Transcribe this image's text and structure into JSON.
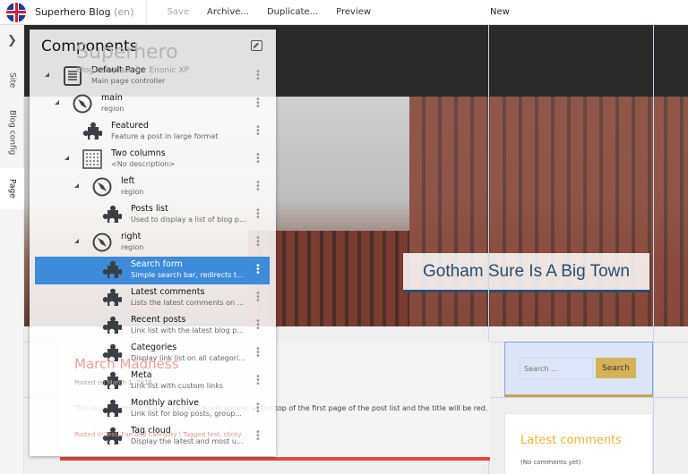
{
  "topbar": {
    "app_name": "Superhero Blog",
    "lang": "(en)",
    "save": "Save",
    "archive": "Archive...",
    "duplicate": "Duplicate...",
    "preview": "Preview",
    "status": "New"
  },
  "leftnav": {
    "tabs": [
      "Site",
      "Blog config",
      "Page"
    ],
    "active": "Page"
  },
  "site": {
    "title": "Superhero",
    "subtitle": "Blog template for Enonic XP",
    "hero_title": "Gotham Sure Is A Big Town"
  },
  "post": {
    "title": "March Madness",
    "meta": "Posted on March 1, 2016",
    "body": "This is an example of a sticky post. It will appear at the top of the first page of the post list and the title will be red.",
    "footer": "Posted in Test, Fun and Category | Tagged test, sticky"
  },
  "search_widget": {
    "placeholder": "Search ...",
    "button": "Search"
  },
  "comments_widget": {
    "title": "Latest comments",
    "empty": "(No comments yet)"
  },
  "components_panel": {
    "title": "Components",
    "items": [
      {
        "name": "Default Page",
        "desc": "Main page controller",
        "icon": "page-icon",
        "level": 0,
        "expandable": true
      },
      {
        "name": "main",
        "desc": "region",
        "icon": "region-icon",
        "level": 1,
        "expandable": true
      },
      {
        "name": "Featured",
        "desc": "Feature a post in large format",
        "icon": "puzzle-icon",
        "level": 2,
        "expandable": false
      },
      {
        "name": "Two columns",
        "desc": "<No description>",
        "icon": "layout-icon",
        "level": 2,
        "expandable": true
      },
      {
        "name": "left",
        "desc": "region",
        "icon": "region-icon",
        "level": 3,
        "expandable": true
      },
      {
        "name": "Posts list",
        "desc": "Used to display a list of blog p...",
        "icon": "puzzle-icon",
        "level": 4,
        "expandable": false
      },
      {
        "name": "right",
        "desc": "region",
        "icon": "region-icon",
        "level": 3,
        "expandable": true
      },
      {
        "name": "Search form",
        "desc": "Simple search bar, redirects t...",
        "icon": "puzzle-icon",
        "level": 4,
        "expandable": false,
        "selected": true
      },
      {
        "name": "Latest comments",
        "desc": "Lists the latest comments on ...",
        "icon": "puzzle-icon",
        "level": 4,
        "expandable": false
      },
      {
        "name": "Recent posts",
        "desc": "Link list with the latest blog p...",
        "icon": "puzzle-icon",
        "level": 4,
        "expandable": false
      },
      {
        "name": "Categories",
        "desc": "Display link list on all categori...",
        "icon": "puzzle-icon",
        "level": 4,
        "expandable": false
      },
      {
        "name": "Meta",
        "desc": "Link list with custom links",
        "icon": "puzzle-icon",
        "level": 4,
        "expandable": false
      },
      {
        "name": "Monthly archive",
        "desc": "Link list for blog posts, group...",
        "icon": "puzzle-icon",
        "level": 4,
        "expandable": false
      },
      {
        "name": "Tag cloud",
        "desc": "Display the latest and most u...",
        "icon": "puzzle-icon",
        "level": 4,
        "expandable": false
      }
    ]
  },
  "colors": {
    "selection": "#3d8bd9",
    "accent_red": "#e04a3f",
    "accent_gold": "#d4b258",
    "hero_blue": "#284d6e"
  }
}
